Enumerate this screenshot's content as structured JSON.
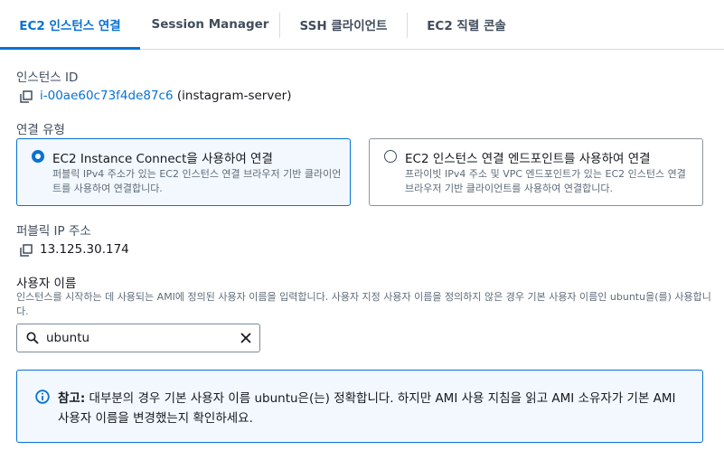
{
  "tabs": [
    {
      "label": "EC2 인스턴스 연결",
      "active": true
    },
    {
      "label": "Session Manager",
      "active": false
    },
    {
      "label": "SSH 클라이언트",
      "active": false
    },
    {
      "label": "EC2 직렬 콘솔",
      "active": false
    }
  ],
  "instance": {
    "label": "인스턴스 ID",
    "id": "i-00ae60c73f4de87c6",
    "name": "(instagram-server)"
  },
  "connection_type": {
    "label": "연결 유형",
    "options": [
      {
        "title": "EC2 Instance Connect을 사용하여 연결",
        "description": "퍼블릭 IPv4 주소가 있는 EC2 인스턴스 연결 브라우저 기반 클라이언트를 사용하여 연결합니다.",
        "selected": true
      },
      {
        "title": "EC2 인스턴스 연결 엔드포인트를 사용하여 연결",
        "description": "프라이빗 IPv4 주소 및 VPC 엔드포인트가 있는 EC2 인스턴스 연결 브라우저 기반 클라이언트를 사용하여 연결합니다.",
        "selected": false
      }
    ]
  },
  "public_ip": {
    "label": "퍼블릭 IP 주소",
    "value": "13.125.30.174"
  },
  "username": {
    "label": "사용자 이름",
    "help": "인스턴스를 시작하는 데 사용되는 AMI에 정의된 사용자 이름을 입력합니다. 사용자 지정 사용자 이름을 정의하지 않은 경우 기본 사용자 이름인 ubuntu을(를) 사용합니다.",
    "value": "ubuntu"
  },
  "note": {
    "prefix": "참고:",
    "text": " 대부분의 경우 기본 사용자 이름 ubuntu은(는) 정확합니다. 하지만 AMI 사용 지침을 읽고 AMI 소유자가 기본 AMI 사용자 이름을 변경했는지 확인하세요."
  },
  "colors": {
    "accent": "#0972d3",
    "info_bg": "#f2f8fd",
    "text": "#16191f",
    "secondary_text": "#5f6b7a"
  },
  "icons": [
    "copy-icon",
    "search-icon",
    "clear-icon",
    "info-icon"
  ]
}
